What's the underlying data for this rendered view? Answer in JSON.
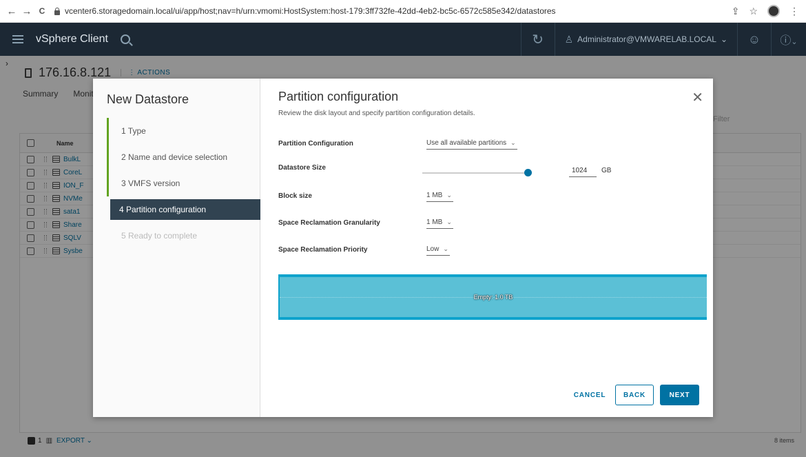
{
  "browser": {
    "url": "vcenter6.storagedomain.local/ui/app/host;nav=h/urn:vmomi:HostSystem:host-179:3ff732fe-42dd-4eb2-bc5c-6572c585e342/datastores",
    "back": "←",
    "forward": "→",
    "reload": "C"
  },
  "app": {
    "title": "vSphere Client",
    "user": "Administrator@VMWARELAB.LOCAL",
    "user_chevron": "⌄",
    "help_chevron": "⌄"
  },
  "host": {
    "name": "176.16.8.121",
    "actions": "ACTIONS",
    "tabs": [
      "Summary",
      "Monit"
    ],
    "filter_placeholder": "Filter",
    "grid_header": "Name",
    "rows": [
      "BulkL",
      "CoreL",
      "ION_F",
      "NVMe",
      "sata1",
      "Share",
      "SQLV",
      "Sysbe"
    ],
    "footer_count": "1",
    "export": "EXPORT",
    "items_count": "8 items"
  },
  "wizard": {
    "title": "New Datastore",
    "steps": [
      {
        "label": "1  Type"
      },
      {
        "label": "2  Name and device selection"
      },
      {
        "label": "3  VMFS version"
      },
      {
        "label": "4  Partition configuration"
      },
      {
        "label": "5  Ready to complete"
      }
    ],
    "active_step": 4,
    "heading": "Partition configuration",
    "subheading": "Review the disk layout and specify partition configuration details.",
    "fields": {
      "partition_config": {
        "label": "Partition Configuration",
        "value": "Use all available partitions"
      },
      "datastore_size": {
        "label": "Datastore Size",
        "value": "1024",
        "unit": "GB",
        "slider_fraction": 1.0
      },
      "block_size": {
        "label": "Block size",
        "value": "1 MB"
      },
      "reclaim_granularity": {
        "label": "Space Reclamation Granularity",
        "value": "1 MB"
      },
      "reclaim_priority": {
        "label": "Space Reclamation Priority",
        "value": "Low"
      }
    },
    "partition_bar_label": "Empty: 1.0 TB",
    "buttons": {
      "cancel": "CANCEL",
      "back": "BACK",
      "next": "NEXT"
    }
  },
  "colors": {
    "header_bg": "#1c2834",
    "accent": "#0072a3",
    "step_done": "#62a420",
    "step_active_bg": "#314351",
    "partition_fill": "#5bc0d6"
  },
  "icons": [
    "back-arrow-icon",
    "forward-arrow-icon",
    "reload-icon",
    "lock-icon",
    "share-icon",
    "star-icon",
    "profile-icon",
    "menu-icon",
    "search-icon",
    "refresh-icon",
    "user-icon",
    "smiley-icon",
    "help-icon",
    "host-icon",
    "close-icon",
    "datastore-icon"
  ]
}
